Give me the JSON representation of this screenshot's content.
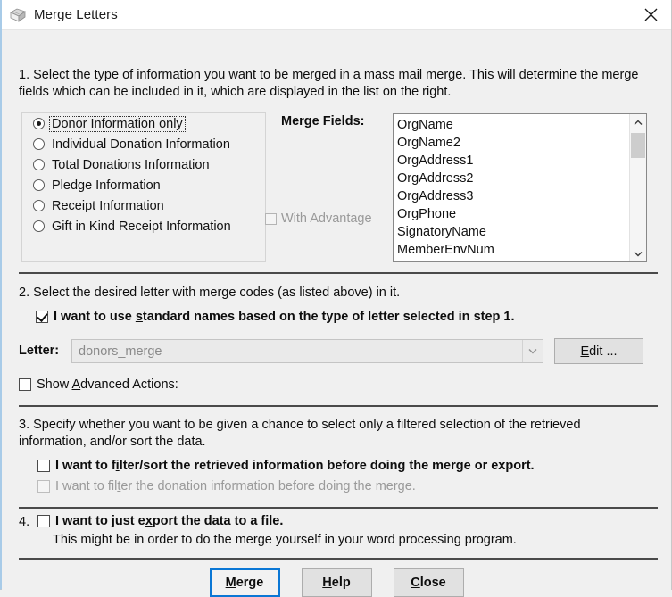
{
  "window": {
    "title": "Merge Letters",
    "icon": "merge-letters-icon",
    "close_icon": "close-icon",
    "accent_color": "#0a77d5",
    "background_color": "#f0f0f0"
  },
  "step1": {
    "text": "1. Select the type of information you want to be merged in a mass mail merge. This will determine the merge fields which can be included in it, which are displayed in the list on the right.",
    "options": [
      {
        "label": "Donor Information only",
        "checked": true,
        "focused": true
      },
      {
        "label": "Individual Donation Information",
        "checked": false,
        "focused": false
      },
      {
        "label": "Total Donations Information",
        "checked": false,
        "focused": false
      },
      {
        "label": "Pledge Information",
        "checked": false,
        "focused": false
      },
      {
        "label": "Receipt Information",
        "checked": false,
        "focused": false
      },
      {
        "label": "Gift in Kind Receipt Information",
        "checked": false,
        "focused": false
      }
    ],
    "merge_fields_label": "Merge Fields:",
    "with_advantage": {
      "label": "With Advantage",
      "checked": false,
      "disabled": true
    },
    "merge_fields": [
      "OrgName",
      "OrgName2",
      "OrgAddress1",
      "OrgAddress2",
      "OrgAddress3",
      "OrgPhone",
      "SignatoryName",
      "MemberEnvNum"
    ],
    "scrollbar": {
      "up_icon": "chevron-up-icon",
      "down_icon": "chevron-down-icon"
    }
  },
  "step2": {
    "text": "2. Select the desired letter with merge codes (as listed above) in it.",
    "standard_names": {
      "prefix": "I want to use ",
      "accel": "s",
      "suffix": "tandard names based on the type of letter selected in step 1.",
      "checked": true
    },
    "letter_label": "Letter:",
    "letter_value": "donors_merge",
    "letter_dropdown_icon": "chevron-down-icon",
    "letter_disabled": true,
    "edit_button": {
      "prefix": "",
      "accel": "E",
      "suffix": "dit ..."
    },
    "show_advanced": {
      "prefix": "Show ",
      "accel": "A",
      "suffix": "dvanced Actions:",
      "checked": false
    }
  },
  "step3": {
    "text": "3. Specify whether you want to be given a chance to select only a filtered selection of the retrieved information, and/or sort the data.",
    "filter_sort": {
      "prefix": "I want to f",
      "accel": "i",
      "suffix": "lter/sort the retrieved information before doing the merge or export.",
      "checked": false,
      "disabled": false
    },
    "filter_donation": {
      "prefix": "I want to fil",
      "accel": "t",
      "suffix": "er the donation information before doing the merge.",
      "checked": false,
      "disabled": true
    }
  },
  "step4": {
    "number": "4.",
    "export": {
      "prefix": "I want to just e",
      "accel": "x",
      "suffix": "port the data to a file.",
      "checked": false
    },
    "note": "This might be in order to do the merge yourself in your word processing program."
  },
  "buttons": {
    "merge": {
      "prefix": "",
      "accel": "M",
      "suffix": "erge",
      "primary": true
    },
    "help": {
      "prefix": "",
      "accel": "H",
      "suffix": "elp",
      "primary": false
    },
    "close": {
      "prefix": "",
      "accel": "C",
      "suffix": "lose",
      "primary": false
    }
  }
}
